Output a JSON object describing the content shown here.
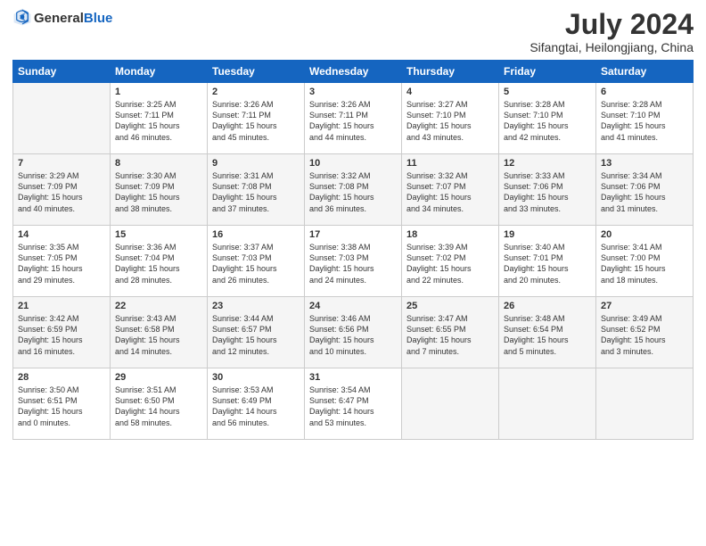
{
  "header": {
    "logo_general": "General",
    "logo_blue": "Blue",
    "month_year": "July 2024",
    "location": "Sifangtai, Heilongjiang, China"
  },
  "calendar": {
    "days_of_week": [
      "Sunday",
      "Monday",
      "Tuesday",
      "Wednesday",
      "Thursday",
      "Friday",
      "Saturday"
    ],
    "weeks": [
      [
        {
          "day": "",
          "info": ""
        },
        {
          "day": "1",
          "info": "Sunrise: 3:25 AM\nSunset: 7:11 PM\nDaylight: 15 hours\nand 46 minutes."
        },
        {
          "day": "2",
          "info": "Sunrise: 3:26 AM\nSunset: 7:11 PM\nDaylight: 15 hours\nand 45 minutes."
        },
        {
          "day": "3",
          "info": "Sunrise: 3:26 AM\nSunset: 7:11 PM\nDaylight: 15 hours\nand 44 minutes."
        },
        {
          "day": "4",
          "info": "Sunrise: 3:27 AM\nSunset: 7:10 PM\nDaylight: 15 hours\nand 43 minutes."
        },
        {
          "day": "5",
          "info": "Sunrise: 3:28 AM\nSunset: 7:10 PM\nDaylight: 15 hours\nand 42 minutes."
        },
        {
          "day": "6",
          "info": "Sunrise: 3:28 AM\nSunset: 7:10 PM\nDaylight: 15 hours\nand 41 minutes."
        }
      ],
      [
        {
          "day": "7",
          "info": "Sunrise: 3:29 AM\nSunset: 7:09 PM\nDaylight: 15 hours\nand 40 minutes."
        },
        {
          "day": "8",
          "info": "Sunrise: 3:30 AM\nSunset: 7:09 PM\nDaylight: 15 hours\nand 38 minutes."
        },
        {
          "day": "9",
          "info": "Sunrise: 3:31 AM\nSunset: 7:08 PM\nDaylight: 15 hours\nand 37 minutes."
        },
        {
          "day": "10",
          "info": "Sunrise: 3:32 AM\nSunset: 7:08 PM\nDaylight: 15 hours\nand 36 minutes."
        },
        {
          "day": "11",
          "info": "Sunrise: 3:32 AM\nSunset: 7:07 PM\nDaylight: 15 hours\nand 34 minutes."
        },
        {
          "day": "12",
          "info": "Sunrise: 3:33 AM\nSunset: 7:06 PM\nDaylight: 15 hours\nand 33 minutes."
        },
        {
          "day": "13",
          "info": "Sunrise: 3:34 AM\nSunset: 7:06 PM\nDaylight: 15 hours\nand 31 minutes."
        }
      ],
      [
        {
          "day": "14",
          "info": "Sunrise: 3:35 AM\nSunset: 7:05 PM\nDaylight: 15 hours\nand 29 minutes."
        },
        {
          "day": "15",
          "info": "Sunrise: 3:36 AM\nSunset: 7:04 PM\nDaylight: 15 hours\nand 28 minutes."
        },
        {
          "day": "16",
          "info": "Sunrise: 3:37 AM\nSunset: 7:03 PM\nDaylight: 15 hours\nand 26 minutes."
        },
        {
          "day": "17",
          "info": "Sunrise: 3:38 AM\nSunset: 7:03 PM\nDaylight: 15 hours\nand 24 minutes."
        },
        {
          "day": "18",
          "info": "Sunrise: 3:39 AM\nSunset: 7:02 PM\nDaylight: 15 hours\nand 22 minutes."
        },
        {
          "day": "19",
          "info": "Sunrise: 3:40 AM\nSunset: 7:01 PM\nDaylight: 15 hours\nand 20 minutes."
        },
        {
          "day": "20",
          "info": "Sunrise: 3:41 AM\nSunset: 7:00 PM\nDaylight: 15 hours\nand 18 minutes."
        }
      ],
      [
        {
          "day": "21",
          "info": "Sunrise: 3:42 AM\nSunset: 6:59 PM\nDaylight: 15 hours\nand 16 minutes."
        },
        {
          "day": "22",
          "info": "Sunrise: 3:43 AM\nSunset: 6:58 PM\nDaylight: 15 hours\nand 14 minutes."
        },
        {
          "day": "23",
          "info": "Sunrise: 3:44 AM\nSunset: 6:57 PM\nDaylight: 15 hours\nand 12 minutes."
        },
        {
          "day": "24",
          "info": "Sunrise: 3:46 AM\nSunset: 6:56 PM\nDaylight: 15 hours\nand 10 minutes."
        },
        {
          "day": "25",
          "info": "Sunrise: 3:47 AM\nSunset: 6:55 PM\nDaylight: 15 hours\nand 7 minutes."
        },
        {
          "day": "26",
          "info": "Sunrise: 3:48 AM\nSunset: 6:54 PM\nDaylight: 15 hours\nand 5 minutes."
        },
        {
          "day": "27",
          "info": "Sunrise: 3:49 AM\nSunset: 6:52 PM\nDaylight: 15 hours\nand 3 minutes."
        }
      ],
      [
        {
          "day": "28",
          "info": "Sunrise: 3:50 AM\nSunset: 6:51 PM\nDaylight: 15 hours\nand 0 minutes."
        },
        {
          "day": "29",
          "info": "Sunrise: 3:51 AM\nSunset: 6:50 PM\nDaylight: 14 hours\nand 58 minutes."
        },
        {
          "day": "30",
          "info": "Sunrise: 3:53 AM\nSunset: 6:49 PM\nDaylight: 14 hours\nand 56 minutes."
        },
        {
          "day": "31",
          "info": "Sunrise: 3:54 AM\nSunset: 6:47 PM\nDaylight: 14 hours\nand 53 minutes."
        },
        {
          "day": "",
          "info": ""
        },
        {
          "day": "",
          "info": ""
        },
        {
          "day": "",
          "info": ""
        }
      ]
    ]
  }
}
